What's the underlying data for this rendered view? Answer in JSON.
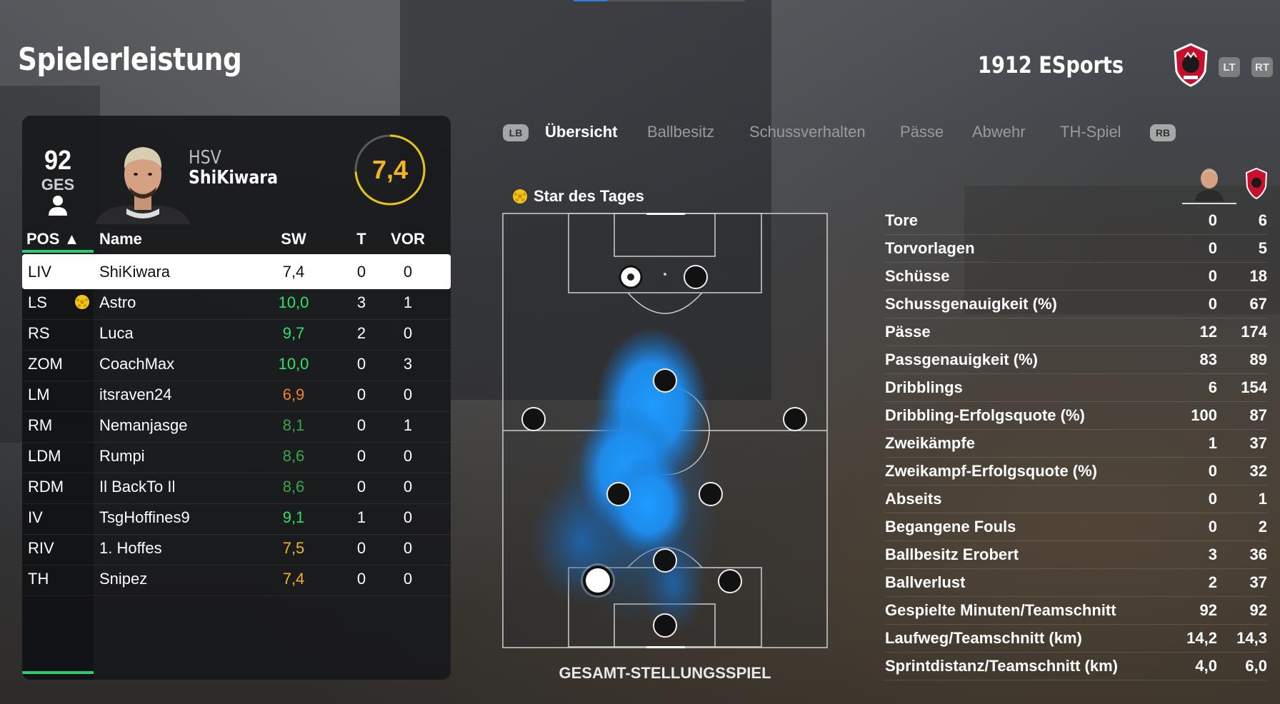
{
  "header": {
    "title": "Spielerleistung",
    "club": "1912 ESports",
    "lt": "LT",
    "rt": "RT"
  },
  "player": {
    "overall": "92",
    "overall_label": "GES",
    "club": "HSV",
    "name": "ShiKiwara",
    "rating": "7,4",
    "rating_fraction": 0.74
  },
  "table": {
    "headers": {
      "pos": "POS ▲",
      "name": "Name",
      "sw": "SW",
      "t": "T",
      "vor": "VOR"
    },
    "rows": [
      {
        "pos": "LIV",
        "name": "ShiKiwara",
        "sw": "7,4",
        "t": "0",
        "vor": "0",
        "sw_color": "#111111",
        "selected": true,
        "star": false
      },
      {
        "pos": "LS",
        "name": "Astro",
        "sw": "10,0",
        "t": "3",
        "vor": "1",
        "sw_color": "#2ee06a",
        "selected": false,
        "star": true
      },
      {
        "pos": "RS",
        "name": "Luca",
        "sw": "9,7",
        "t": "2",
        "vor": "0",
        "sw_color": "#2ee06a",
        "selected": false,
        "star": false
      },
      {
        "pos": "ZOM",
        "name": "CoachMax",
        "sw": "10,0",
        "t": "0",
        "vor": "3",
        "sw_color": "#2ee06a",
        "selected": false,
        "star": false
      },
      {
        "pos": "LM",
        "name": "itsraven24",
        "sw": "6,9",
        "t": "0",
        "vor": "0",
        "sw_color": "#f0802a",
        "selected": false,
        "star": false
      },
      {
        "pos": "RM",
        "name": "Nemanjasge",
        "sw": "8,1",
        "t": "0",
        "vor": "1",
        "sw_color": "#3fa34d",
        "selected": false,
        "star": false
      },
      {
        "pos": "LDM",
        "name": "Rumpi",
        "sw": "8,6",
        "t": "0",
        "vor": "0",
        "sw_color": "#3fa34d",
        "selected": false,
        "star": false
      },
      {
        "pos": "RDM",
        "name": "Il BackTo Il",
        "sw": "8,6",
        "t": "0",
        "vor": "0",
        "sw_color": "#3fa34d",
        "selected": false,
        "star": false
      },
      {
        "pos": "IV",
        "name": "TsgHoffines9",
        "sw": "9,1",
        "t": "1",
        "vor": "0",
        "sw_color": "#2ee06a",
        "selected": false,
        "star": false
      },
      {
        "pos": "RIV",
        "name": "1. Hoffes",
        "sw": "7,5",
        "t": "0",
        "vor": "0",
        "sw_color": "#f3b423",
        "selected": false,
        "star": false
      },
      {
        "pos": "TH",
        "name": "Snipez",
        "sw": "7,4",
        "t": "0",
        "vor": "0",
        "sw_color": "#f3b423",
        "selected": false,
        "star": false
      }
    ]
  },
  "tabs": {
    "lb": "LB",
    "rb": "RB",
    "items": [
      "Übersicht",
      "Ballbesitz",
      "Schussverhalten",
      "Pässe",
      "Abwehr",
      "TH-Spiel"
    ],
    "active": 0
  },
  "pitch": {
    "star_label": "Star des Tages",
    "caption": "GESAMT-STELLUNGSSPIEL"
  },
  "stats": [
    {
      "label": "Tore",
      "player": "0",
      "team": "6"
    },
    {
      "label": "Torvorlagen",
      "player": "0",
      "team": "5"
    },
    {
      "label": "Schüsse",
      "player": "0",
      "team": "18"
    },
    {
      "label": "Schussgenauigkeit (%)",
      "player": "0",
      "team": "67"
    },
    {
      "label": "Pässe",
      "player": "12",
      "team": "174"
    },
    {
      "label": "Passgenauigkeit (%)",
      "player": "83",
      "team": "89"
    },
    {
      "label": "Dribblings",
      "player": "6",
      "team": "154"
    },
    {
      "label": "Dribbling-Erfolgsquote (%)",
      "player": "100",
      "team": "87"
    },
    {
      "label": "Zweikämpfe",
      "player": "1",
      "team": "37"
    },
    {
      "label": "Zweikampf-Erfolgsquote (%)",
      "player": "0",
      "team": "32"
    },
    {
      "label": "Abseits",
      "player": "0",
      "team": "1"
    },
    {
      "label": "Begangene Fouls",
      "player": "0",
      "team": "2"
    },
    {
      "label": "Ballbesitz Erobert",
      "player": "3",
      "team": "36"
    },
    {
      "label": "Ballverlust",
      "player": "2",
      "team": "37"
    },
    {
      "label": "Gespielte Minuten/Teamschnitt",
      "player": "92",
      "team": "92"
    },
    {
      "label": "Laufweg/Teamschnitt (km)",
      "player": "14,2",
      "team": "14,3"
    },
    {
      "label": "Sprintdistanz/Teamschnitt (km)",
      "player": "4,0",
      "team": "6,0"
    }
  ],
  "colors": {
    "accent_green": "#2ecc71",
    "rating_gold": "#f3b423",
    "heatmap_blue": "#1e90ff"
  }
}
